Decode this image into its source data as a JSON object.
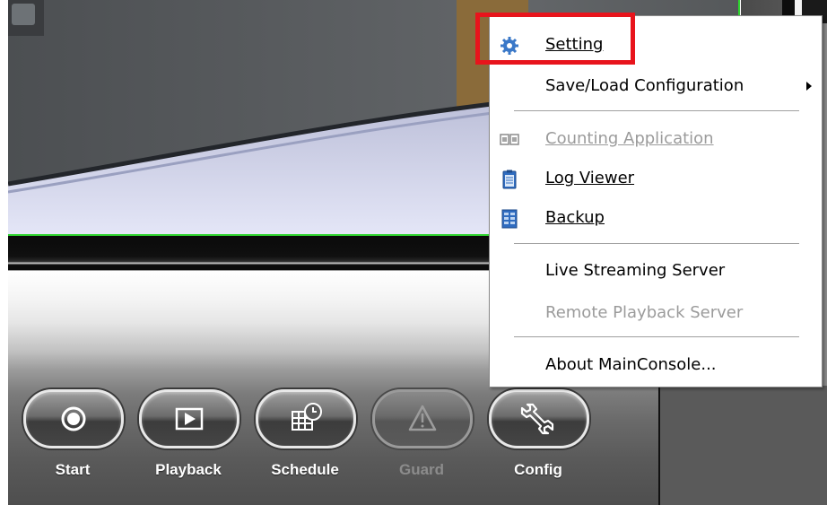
{
  "context_menu": {
    "items": [
      {
        "label": "Setting",
        "mnemonic": "S",
        "icon": "gear-icon",
        "enabled": true
      },
      {
        "label": "Save/Load Configuration",
        "has_submenu": true,
        "enabled": true
      },
      {
        "label": "Counting Application",
        "mnemonic": "C",
        "icon": "counter-icon",
        "enabled": false
      },
      {
        "label": "Log Viewer",
        "mnemonic": "L",
        "icon": "clipboard-icon",
        "enabled": true
      },
      {
        "label": "Backup",
        "mnemonic": "B",
        "icon": "backup-icon",
        "enabled": true
      },
      {
        "label": "Live Streaming Server",
        "enabled": true
      },
      {
        "label": "Remote Playback Server",
        "enabled": false
      },
      {
        "label": "About MainConsole...",
        "enabled": true
      }
    ],
    "highlight_color": "#e8141c"
  },
  "toolbar": {
    "buttons": [
      {
        "label": "Start",
        "icon": "record-icon",
        "enabled": true
      },
      {
        "label": "Playback",
        "icon": "play-icon",
        "enabled": true
      },
      {
        "label": "Schedule",
        "icon": "calendar-clock-icon",
        "enabled": true
      },
      {
        "label": "Guard",
        "icon": "warning-icon",
        "enabled": false
      },
      {
        "label": "Config",
        "icon": "wrench-icon",
        "enabled": true
      }
    ]
  },
  "colors": {
    "video_border": "#2fd52f",
    "menu_disabled_text": "#9b9b9b"
  }
}
